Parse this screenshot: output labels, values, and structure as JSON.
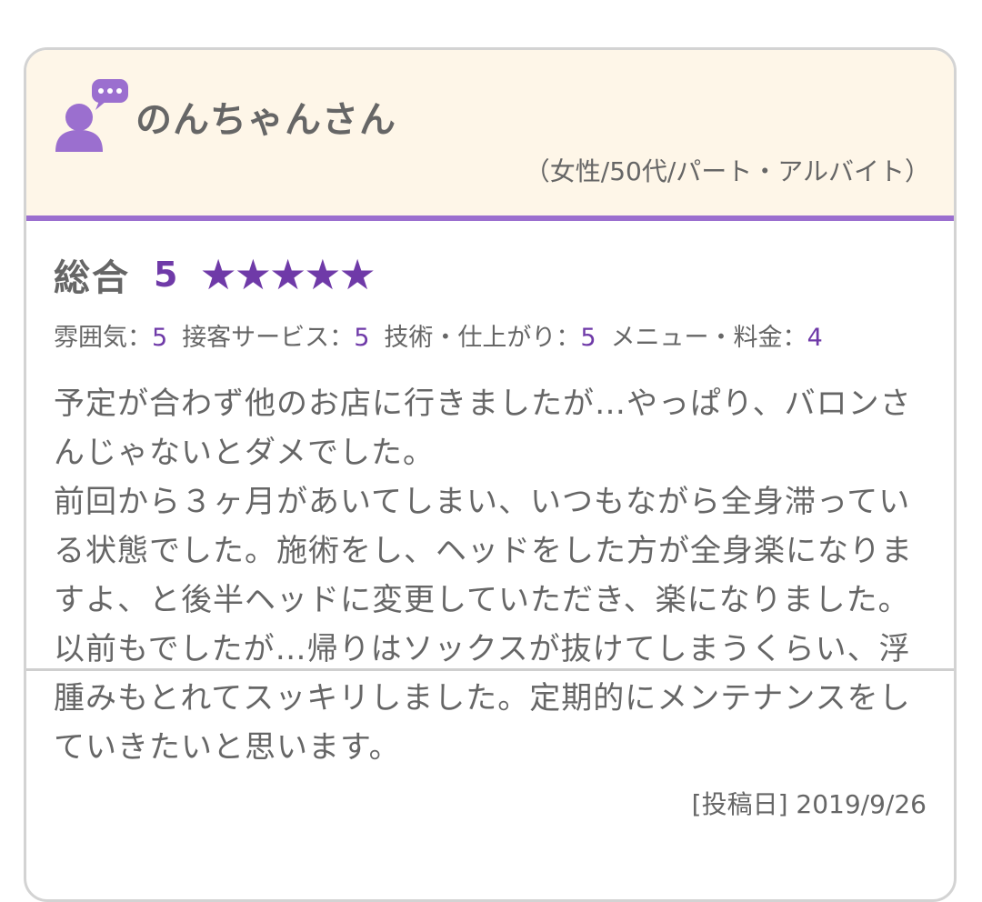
{
  "review": {
    "reviewer_name": "のんちゃんさん",
    "reviewer_meta": "（女性/50代/パート・アルバイト）",
    "overall_label": "総合",
    "overall_score": "5",
    "overall_stars": 5,
    "star_glyph": "★",
    "sub_ratings": [
      {
        "label": "雰囲気：",
        "value": "5"
      },
      {
        "label": "接客サービス：",
        "value": "5"
      },
      {
        "label": "技術・仕上がり：",
        "value": "5"
      },
      {
        "label": "メニュー・料金：",
        "value": "4"
      }
    ],
    "text": "予定が合わず他のお店に行きましたが…やっぱり、バロンさんじゃないとダメでした。\n前回から３ヶ月があいてしまい、いつもながら全身滞っている状態でした。施術をし、ヘッドをした方が全身楽になりますよ、と後半ヘッドに変更していただき、楽になりました。以前もでしたが…帰りはソックスが抜けてしまうくらい、浮腫みもとれてスッキリしました。定期的にメンテナンスをしていきたいと思います。",
    "post_date": "[投稿日] 2019/9/26"
  },
  "icons": {
    "avatar": "person-speech-bubble-icon",
    "star": "star-icon"
  },
  "colors": {
    "accent": "#6f3aa8",
    "icon": "#9b6fcf",
    "header_bg": "#fef6e8",
    "text": "#666666",
    "border": "#d3d3d3"
  }
}
